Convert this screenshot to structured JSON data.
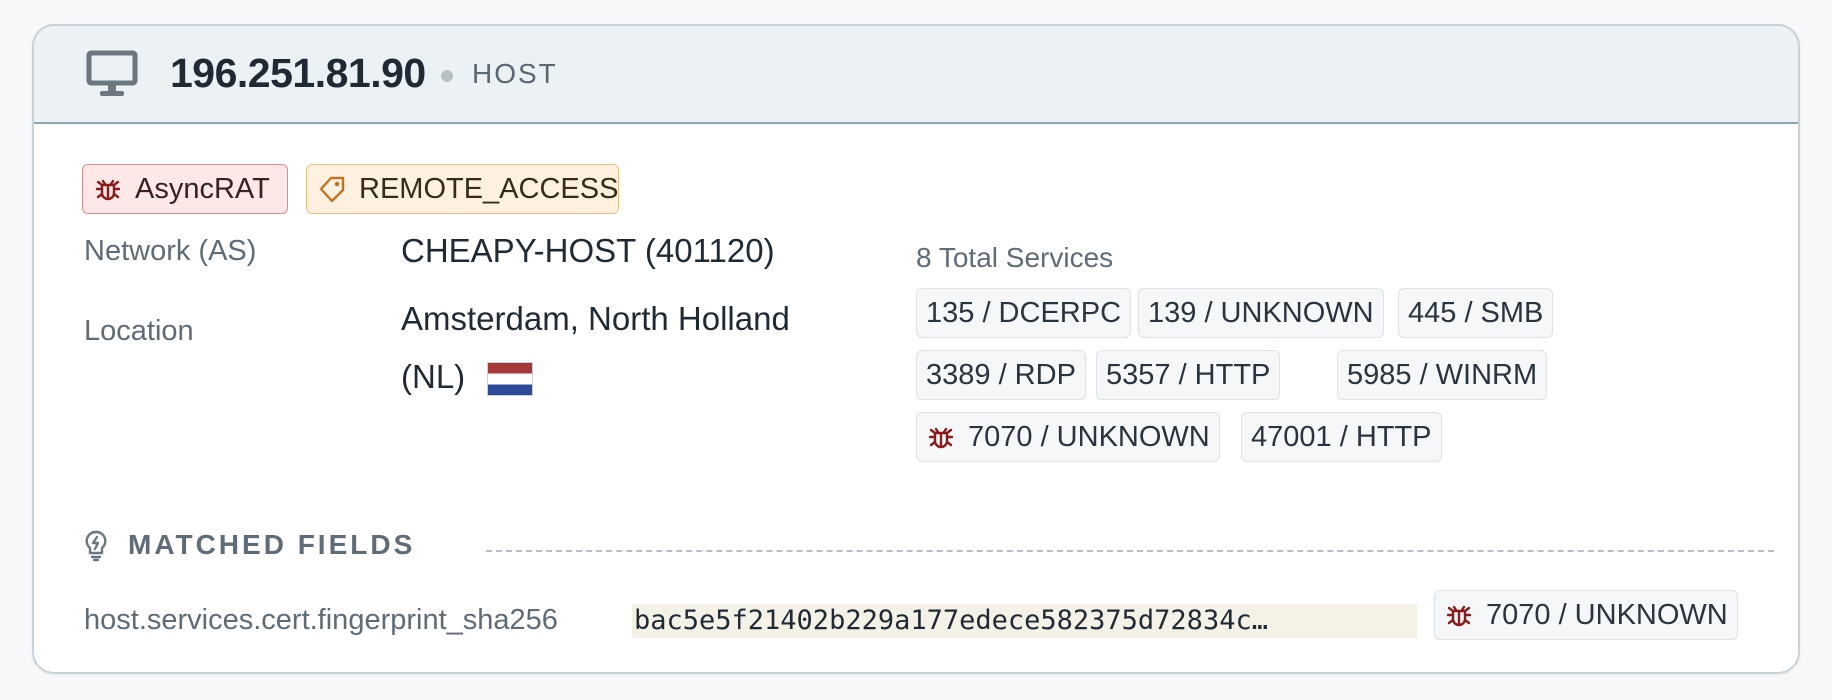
{
  "header": {
    "icon": "monitor-icon",
    "ip": "196.251.81.90",
    "kind": "HOST"
  },
  "tags": [
    {
      "icon": "bug-icon",
      "label": "AsyncRAT",
      "color": "#fde8e8",
      "icon_color": "#8b1a1a"
    },
    {
      "icon": "tag-icon",
      "label": "REMOTE_ACCESS",
      "color": "#fff1e0",
      "icon_color": "#c07324"
    }
  ],
  "fields": {
    "network_label": "Network (AS)",
    "network_value": "CHEAPY-HOST (401120)",
    "location_label": "Location",
    "location_line1": "Amsterdam, North Holland",
    "location_line2": "(NL)",
    "location_flag": "nl-flag-icon"
  },
  "services": {
    "title": "8 Total Services",
    "items": [
      {
        "label": "135 / DCERPC",
        "flagged": false
      },
      {
        "label": "139 / UNKNOWN",
        "flagged": false
      },
      {
        "label": "445 / SMB",
        "flagged": false
      },
      {
        "label": "3389 / RDP",
        "flagged": false
      },
      {
        "label": "5357 / HTTP",
        "flagged": false
      },
      {
        "label": "5985 / WINRM",
        "flagged": false
      },
      {
        "label": "7070 / UNKNOWN",
        "flagged": true
      },
      {
        "label": "47001 / HTTP",
        "flagged": false
      }
    ]
  },
  "matched": {
    "title": "MATCHED FIELDS",
    "icon": "lightbulb-icon",
    "field": "host.services.cert.fingerprint_sha256",
    "value": "bac5e5f21402b229a177edece582375d72834c…",
    "service": "7070 / UNKNOWN"
  },
  "colors": {
    "header_bg": "#ecf2f4",
    "danger": "#8b1a1a",
    "warning": "#c07324",
    "muted_text": "#5f6b76"
  }
}
